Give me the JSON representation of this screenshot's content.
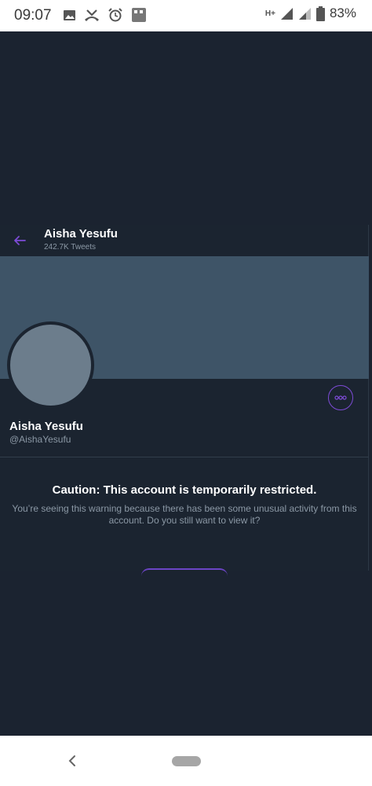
{
  "status_bar": {
    "time": "09:07",
    "network_label": "H+",
    "battery": "83%",
    "icons": [
      "image-icon",
      "missed-call-icon",
      "alarm-icon",
      "app-grid-icon",
      "signal-icon",
      "signal-weak-icon",
      "battery-icon"
    ]
  },
  "header": {
    "name": "Aisha Yesufu",
    "tweets": "242.7K Tweets",
    "back_icon": "back-arrow-icon"
  },
  "profile": {
    "name": "Aisha Yesufu",
    "handle": "@AishaYesufu",
    "more_icon": "more-icon"
  },
  "caution": {
    "title": "Caution: This account is temporarily restricted.",
    "text": "You’re seeing this warning because there has been some unusual activity from this account. Do you still want to view it?"
  },
  "colors": {
    "background": "#1b2330",
    "banner": "#3e5467",
    "avatar": "#6c7d8c",
    "accent": "#7d4bd6",
    "secondary_text": "#8b98a5"
  }
}
